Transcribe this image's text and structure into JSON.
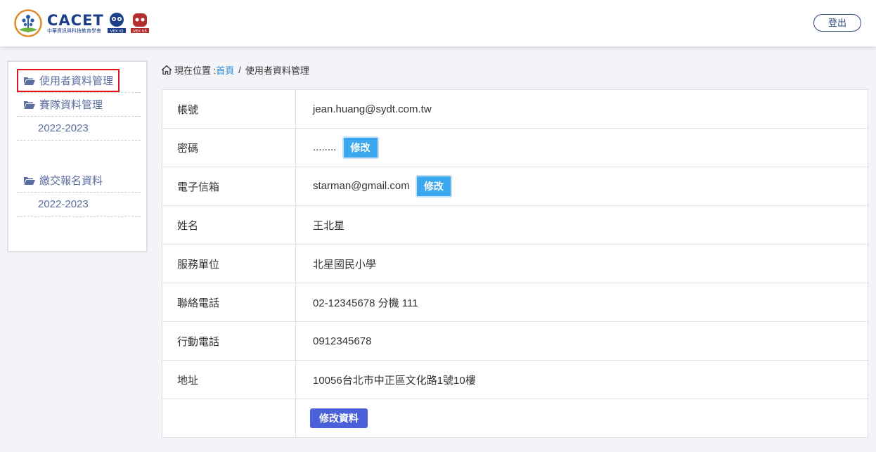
{
  "header": {
    "logo_title": "CACET",
    "logo_subtitle": "中華資訊與科技教育學會",
    "logout_label": "登出"
  },
  "sidebar": {
    "items": [
      {
        "label": "使用者資料管理",
        "icon": "folder-open-icon"
      },
      {
        "label": "賽隊資料管理",
        "icon": "folder-open-icon"
      },
      {
        "label": "2022-2023"
      },
      {
        "label": "繳交報名資料",
        "icon": "folder-open-icon"
      },
      {
        "label": "2022-2023"
      }
    ]
  },
  "breadcrumb": {
    "prefix": "現在位置 :",
    "home": "首頁",
    "separator": "/",
    "current": "使用者資料管理"
  },
  "profile": {
    "rows": [
      {
        "label": "帳號",
        "value": "jean.huang@sydt.com.tw"
      },
      {
        "label": "密碼",
        "value": "........",
        "button": "修改"
      },
      {
        "label": "電子信箱",
        "value": "starman@gmail.com",
        "button": "修改"
      },
      {
        "label": "姓名",
        "value": "王北星"
      },
      {
        "label": "服務單位",
        "value": "北星國民小學"
      },
      {
        "label": "聯絡電話",
        "value": "02-12345678 分機 111"
      },
      {
        "label": "行動電話",
        "value": "0912345678"
      },
      {
        "label": "地址",
        "value": "10056台北市中正區文化路1號10樓"
      }
    ],
    "save_label": "修改資料"
  },
  "colors": {
    "brand_navy": "#1d3f87",
    "sidebar_link": "#5b6d9f",
    "edit_button": "#3aa7ee",
    "save_button": "#4a60d9",
    "highlight": "#e0141a"
  }
}
